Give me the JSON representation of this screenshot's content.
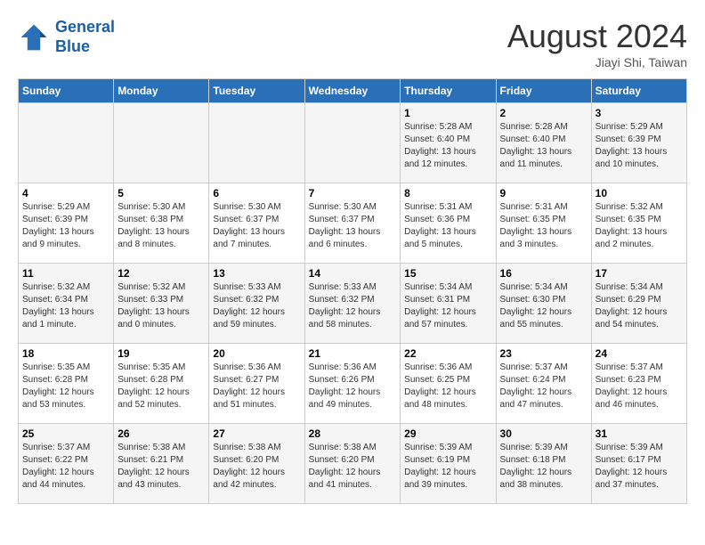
{
  "logo": {
    "line1": "General",
    "line2": "Blue"
  },
  "title": "August 2024",
  "subtitle": "Jiayi Shi, Taiwan",
  "days_of_week": [
    "Sunday",
    "Monday",
    "Tuesday",
    "Wednesday",
    "Thursday",
    "Friday",
    "Saturday"
  ],
  "weeks": [
    [
      {
        "day": "",
        "info": ""
      },
      {
        "day": "",
        "info": ""
      },
      {
        "day": "",
        "info": ""
      },
      {
        "day": "",
        "info": ""
      },
      {
        "day": "1",
        "info": "Sunrise: 5:28 AM\nSunset: 6:40 PM\nDaylight: 13 hours\nand 12 minutes."
      },
      {
        "day": "2",
        "info": "Sunrise: 5:28 AM\nSunset: 6:40 PM\nDaylight: 13 hours\nand 11 minutes."
      },
      {
        "day": "3",
        "info": "Sunrise: 5:29 AM\nSunset: 6:39 PM\nDaylight: 13 hours\nand 10 minutes."
      }
    ],
    [
      {
        "day": "4",
        "info": "Sunrise: 5:29 AM\nSunset: 6:39 PM\nDaylight: 13 hours\nand 9 minutes."
      },
      {
        "day": "5",
        "info": "Sunrise: 5:30 AM\nSunset: 6:38 PM\nDaylight: 13 hours\nand 8 minutes."
      },
      {
        "day": "6",
        "info": "Sunrise: 5:30 AM\nSunset: 6:37 PM\nDaylight: 13 hours\nand 7 minutes."
      },
      {
        "day": "7",
        "info": "Sunrise: 5:30 AM\nSunset: 6:37 PM\nDaylight: 13 hours\nand 6 minutes."
      },
      {
        "day": "8",
        "info": "Sunrise: 5:31 AM\nSunset: 6:36 PM\nDaylight: 13 hours\nand 5 minutes."
      },
      {
        "day": "9",
        "info": "Sunrise: 5:31 AM\nSunset: 6:35 PM\nDaylight: 13 hours\nand 3 minutes."
      },
      {
        "day": "10",
        "info": "Sunrise: 5:32 AM\nSunset: 6:35 PM\nDaylight: 13 hours\nand 2 minutes."
      }
    ],
    [
      {
        "day": "11",
        "info": "Sunrise: 5:32 AM\nSunset: 6:34 PM\nDaylight: 13 hours\nand 1 minute."
      },
      {
        "day": "12",
        "info": "Sunrise: 5:32 AM\nSunset: 6:33 PM\nDaylight: 13 hours\nand 0 minutes."
      },
      {
        "day": "13",
        "info": "Sunrise: 5:33 AM\nSunset: 6:32 PM\nDaylight: 12 hours\nand 59 minutes."
      },
      {
        "day": "14",
        "info": "Sunrise: 5:33 AM\nSunset: 6:32 PM\nDaylight: 12 hours\nand 58 minutes."
      },
      {
        "day": "15",
        "info": "Sunrise: 5:34 AM\nSunset: 6:31 PM\nDaylight: 12 hours\nand 57 minutes."
      },
      {
        "day": "16",
        "info": "Sunrise: 5:34 AM\nSunset: 6:30 PM\nDaylight: 12 hours\nand 55 minutes."
      },
      {
        "day": "17",
        "info": "Sunrise: 5:34 AM\nSunset: 6:29 PM\nDaylight: 12 hours\nand 54 minutes."
      }
    ],
    [
      {
        "day": "18",
        "info": "Sunrise: 5:35 AM\nSunset: 6:28 PM\nDaylight: 12 hours\nand 53 minutes."
      },
      {
        "day": "19",
        "info": "Sunrise: 5:35 AM\nSunset: 6:28 PM\nDaylight: 12 hours\nand 52 minutes."
      },
      {
        "day": "20",
        "info": "Sunrise: 5:36 AM\nSunset: 6:27 PM\nDaylight: 12 hours\nand 51 minutes."
      },
      {
        "day": "21",
        "info": "Sunrise: 5:36 AM\nSunset: 6:26 PM\nDaylight: 12 hours\nand 49 minutes."
      },
      {
        "day": "22",
        "info": "Sunrise: 5:36 AM\nSunset: 6:25 PM\nDaylight: 12 hours\nand 48 minutes."
      },
      {
        "day": "23",
        "info": "Sunrise: 5:37 AM\nSunset: 6:24 PM\nDaylight: 12 hours\nand 47 minutes."
      },
      {
        "day": "24",
        "info": "Sunrise: 5:37 AM\nSunset: 6:23 PM\nDaylight: 12 hours\nand 46 minutes."
      }
    ],
    [
      {
        "day": "25",
        "info": "Sunrise: 5:37 AM\nSunset: 6:22 PM\nDaylight: 12 hours\nand 44 minutes."
      },
      {
        "day": "26",
        "info": "Sunrise: 5:38 AM\nSunset: 6:21 PM\nDaylight: 12 hours\nand 43 minutes."
      },
      {
        "day": "27",
        "info": "Sunrise: 5:38 AM\nSunset: 6:20 PM\nDaylight: 12 hours\nand 42 minutes."
      },
      {
        "day": "28",
        "info": "Sunrise: 5:38 AM\nSunset: 6:20 PM\nDaylight: 12 hours\nand 41 minutes."
      },
      {
        "day": "29",
        "info": "Sunrise: 5:39 AM\nSunset: 6:19 PM\nDaylight: 12 hours\nand 39 minutes."
      },
      {
        "day": "30",
        "info": "Sunrise: 5:39 AM\nSunset: 6:18 PM\nDaylight: 12 hours\nand 38 minutes."
      },
      {
        "day": "31",
        "info": "Sunrise: 5:39 AM\nSunset: 6:17 PM\nDaylight: 12 hours\nand 37 minutes."
      }
    ]
  ]
}
